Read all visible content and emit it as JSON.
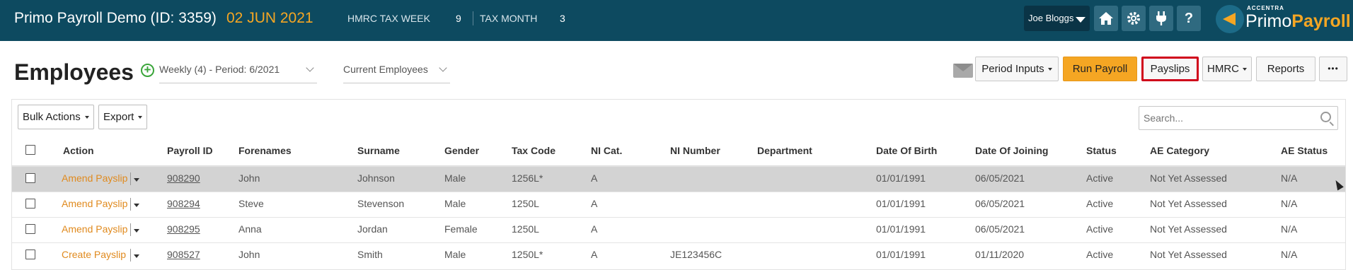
{
  "header": {
    "title": "Primo Payroll Demo (ID: 3359)",
    "date": "02 JUN 2021",
    "tax_week_label": "HMRC TAX WEEK",
    "tax_week_value": "9",
    "tax_month_label": "TAX MONTH",
    "tax_month_value": "3",
    "user": "Joe Bloggs",
    "icons": [
      "home-icon",
      "gear-icon",
      "plug-icon",
      "help-icon"
    ],
    "help_glyph": "?",
    "brand_small": "ACCENTRA",
    "brand_name_1": "Primo",
    "brand_name_2": "Payroll"
  },
  "page": {
    "title": "Employees",
    "add_glyph": "+",
    "period_select": "Weekly (4) - Period: 6/2021",
    "filter_select": "Current Employees"
  },
  "actions": {
    "period_inputs": "Period Inputs",
    "run_payroll": "Run Payroll",
    "payslips": "Payslips",
    "hmrc": "HMRC",
    "reports": "Reports",
    "more": "•••"
  },
  "toolbar": {
    "bulk_actions": "Bulk Actions",
    "export": "Export",
    "search_placeholder": "Search..."
  },
  "table": {
    "columns": [
      "Action",
      "Payroll ID",
      "Forenames",
      "Surname",
      "Gender",
      "Tax Code",
      "NI Cat.",
      "NI Number",
      "Department",
      "Date Of Birth",
      "Date Of Joining",
      "Status",
      "AE Category",
      "AE Status"
    ],
    "rows": [
      {
        "action": "Amend Payslip",
        "payroll_id": "908290",
        "forenames": "John",
        "surname": "Johnson",
        "gender": "Male",
        "tax_code": "1256L*",
        "ni_cat": "A",
        "ni_number": "",
        "department": "",
        "dob": "01/01/1991",
        "doj": "06/05/2021",
        "status": "Active",
        "ae_category": "Not Yet Assessed",
        "ae_status": "N/A"
      },
      {
        "action": "Amend Payslip",
        "payroll_id": "908294",
        "forenames": "Steve",
        "surname": "Stevenson",
        "gender": "Male",
        "tax_code": "1250L",
        "ni_cat": "A",
        "ni_number": "",
        "department": "",
        "dob": "01/01/1991",
        "doj": "06/05/2021",
        "status": "Active",
        "ae_category": "Not Yet Assessed",
        "ae_status": "N/A"
      },
      {
        "action": "Amend Payslip",
        "payroll_id": "908295",
        "forenames": "Anna",
        "surname": "Jordan",
        "gender": "Female",
        "tax_code": "1250L",
        "ni_cat": "A",
        "ni_number": "",
        "department": "",
        "dob": "01/01/1991",
        "doj": "06/05/2021",
        "status": "Active",
        "ae_category": "Not Yet Assessed",
        "ae_status": "N/A"
      },
      {
        "action": "Create Payslip",
        "payroll_id": "908527",
        "forenames": "John",
        "surname": "Smith",
        "gender": "Male",
        "tax_code": "1250L*",
        "ni_cat": "A",
        "ni_number": "JE123456C",
        "department": "",
        "dob": "01/01/1991",
        "doj": "01/11/2020",
        "status": "Active",
        "ae_category": "Not Yet Assessed",
        "ae_status": "N/A"
      }
    ]
  },
  "colors": {
    "topbar": "#0d4a60",
    "accent": "#f5a623",
    "action_link": "#e08a1e",
    "highlight_border": "#d0021b",
    "selected_row": "#d3d3d3"
  }
}
